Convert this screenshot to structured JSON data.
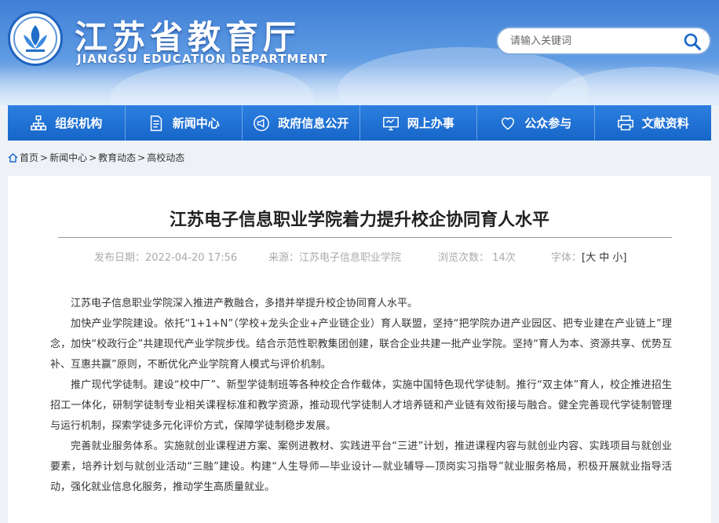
{
  "header": {
    "title": "江苏省教育厅",
    "subtitle": "JIANGSU EDUCATION DEPARTMENT",
    "search_placeholder": "请输入关键词",
    "colors": {
      "primary": "#1766c9",
      "header_top": "#3f7fd6"
    }
  },
  "nav": [
    {
      "label": "组织机构",
      "icon": "org-chart-icon"
    },
    {
      "label": "新闻中心",
      "icon": "document-icon"
    },
    {
      "label": "政府信息公开",
      "icon": "megaphone-icon"
    },
    {
      "label": "网上办事",
      "icon": "monitor-icon"
    },
    {
      "label": "公众参与",
      "icon": "heart-icon"
    },
    {
      "label": "文献资料",
      "icon": "printer-icon"
    }
  ],
  "breadcrumb": [
    "首页",
    "新闻中心",
    "教育动态",
    "高校动态"
  ],
  "article": {
    "title": "江苏电子信息职业学院着力提升校企协同育人水平",
    "date": "发布日期：2022-04-20 17:56",
    "source": "来源：江苏电子信息职业学院",
    "views": "浏览次数：  14次",
    "font_label": "字体：",
    "font_sizes": "[大 中 小]",
    "paragraphs": [
      "江苏电子信息职业学院深入推进产教融合，多措并举提升校企协同育人水平。",
      "加快产业学院建设。依托“1+1+N”（学校+龙头企业+产业链企业）育人联盟，坚持“把学院办进产业园区、把专业建在产业链上”理念，加快“校政行企”共建现代产业学院步伐。结合示范性职教集团创建，联合企业共建一批产业学院。坚持“育人为本、资源共享、优势互补、互惠共赢”原则，不断优化产业学院育人模式与评价机制。",
      "推广现代学徒制。建设“校中厂”、新型学徒制班等各种校企合作载体，实施中国特色现代学徒制。推行“双主体”育人，校企推进招生招工一体化，研制学徒制专业相关课程标准和教学资源，推动现代学徒制人才培养链和产业链有效衔接与融合。健全完善现代学徒制管理与运行机制，探索学徒多元化评价方式，保障学徒制稳步发展。",
      "完善就业服务体系。实施就创业课程进方案、案例进教材、实践进平台“三进”计划，推进课程内容与就创业内容、实践项目与就创业要素，培养计划与就创业活动“三融”建设。构建“人生导师—毕业设计—就业辅导—顶岗实习指导”就业服务格局，积极开展就业指导活动，强化就业信息化服务，推动学生高质量就业。"
    ]
  }
}
